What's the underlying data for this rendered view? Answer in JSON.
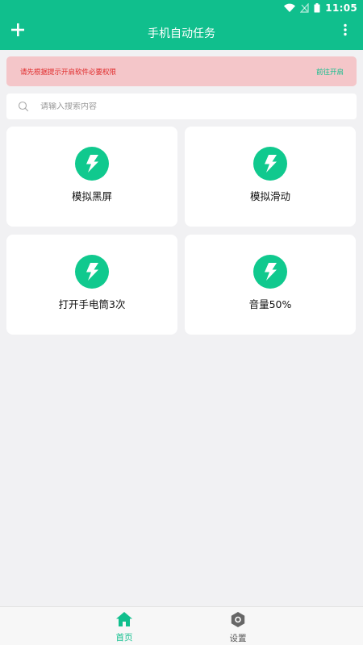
{
  "status_bar": {
    "time": "11:05"
  },
  "toolbar": {
    "title": "手机自动任务"
  },
  "notice": {
    "text": "请先根据提示开启软件必要权限",
    "link": "前往开启"
  },
  "search": {
    "placeholder": "请输入搜索内容"
  },
  "tasks": [
    {
      "label": "模拟黑屏",
      "icon": "lightning-icon"
    },
    {
      "label": "模拟滑动",
      "icon": "lightning-icon"
    },
    {
      "label": "打开手电筒3次",
      "icon": "lightning-icon"
    },
    {
      "label": "音量50%",
      "icon": "lightning-icon"
    }
  ],
  "bottom_nav": {
    "items": [
      {
        "label": "首页",
        "icon": "home-icon",
        "active": true
      },
      {
        "label": "设置",
        "icon": "settings-icon",
        "active": false
      }
    ]
  },
  "colors": {
    "primary": "#10bf8d",
    "notice_bg": "#f4c6c9",
    "notice_text": "#e02a2a",
    "background": "#f1f1f3"
  }
}
